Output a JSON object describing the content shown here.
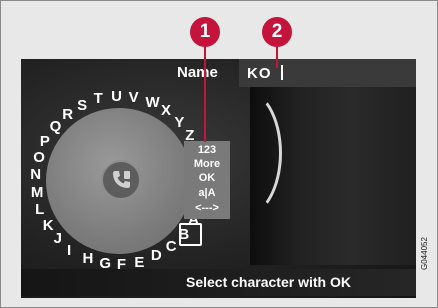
{
  "screen": {
    "name_label": "Name",
    "name_value": "KO",
    "status_text": "Select character with OK"
  },
  "wheel": {
    "letters": [
      "A",
      "B",
      "C",
      "D",
      "E",
      "F",
      "G",
      "H",
      "I",
      "J",
      "K",
      "L",
      "M",
      "N",
      "O",
      "P",
      "Q",
      "R",
      "S",
      "T",
      "U",
      "V",
      "W",
      "X",
      "Y",
      "Z"
    ],
    "center_icon": "phone-icon"
  },
  "menu": {
    "items": [
      "123",
      "More",
      "OK",
      "a|A",
      "<--->"
    ]
  },
  "callouts": [
    "1",
    "2"
  ],
  "figure_code": "G044052",
  "colors": {
    "callout": "#c4143c",
    "screen_bg": "#222222",
    "dial": "#7c7c7c",
    "menu": "#7a7a7a"
  }
}
